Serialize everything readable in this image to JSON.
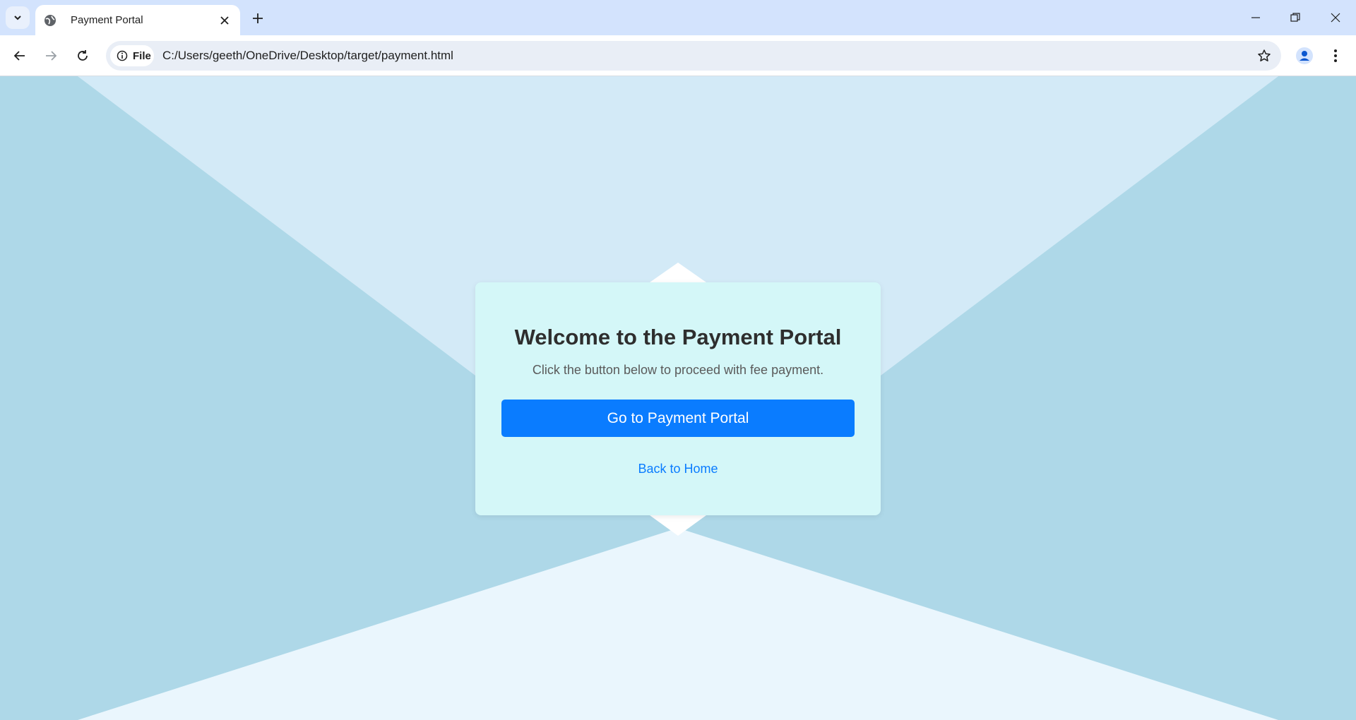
{
  "browser": {
    "tab_title": "Payment Portal",
    "address_chip_label": "File",
    "url": "C:/Users/geeth/OneDrive/Desktop/target/payment.html",
    "icons": {
      "tab_search": "chevron-down-icon",
      "favicon": "globe-icon",
      "tab_close": "close-icon",
      "new_tab": "plus-icon",
      "minimize": "minimize-icon",
      "restore": "restore-icon",
      "window_close": "close-icon",
      "back": "arrow-left-icon",
      "forward": "arrow-right-icon",
      "reload": "reload-icon",
      "site_info": "info-icon",
      "bookmark": "star-icon",
      "profile": "person-icon",
      "menu": "more-vertical-icon"
    }
  },
  "page": {
    "heading": "Welcome to the Payment Portal",
    "subtext": "Click the button below to proceed with fee payment.",
    "primary_button": "Go to Payment Portal",
    "back_link": "Back to Home"
  },
  "colors": {
    "accent": "#0a7cff",
    "card_background": "#d4f7f8",
    "page_background": "#eaf6fd",
    "side_panels": "#aed8e8",
    "top_panel": "#d3eaf7"
  }
}
